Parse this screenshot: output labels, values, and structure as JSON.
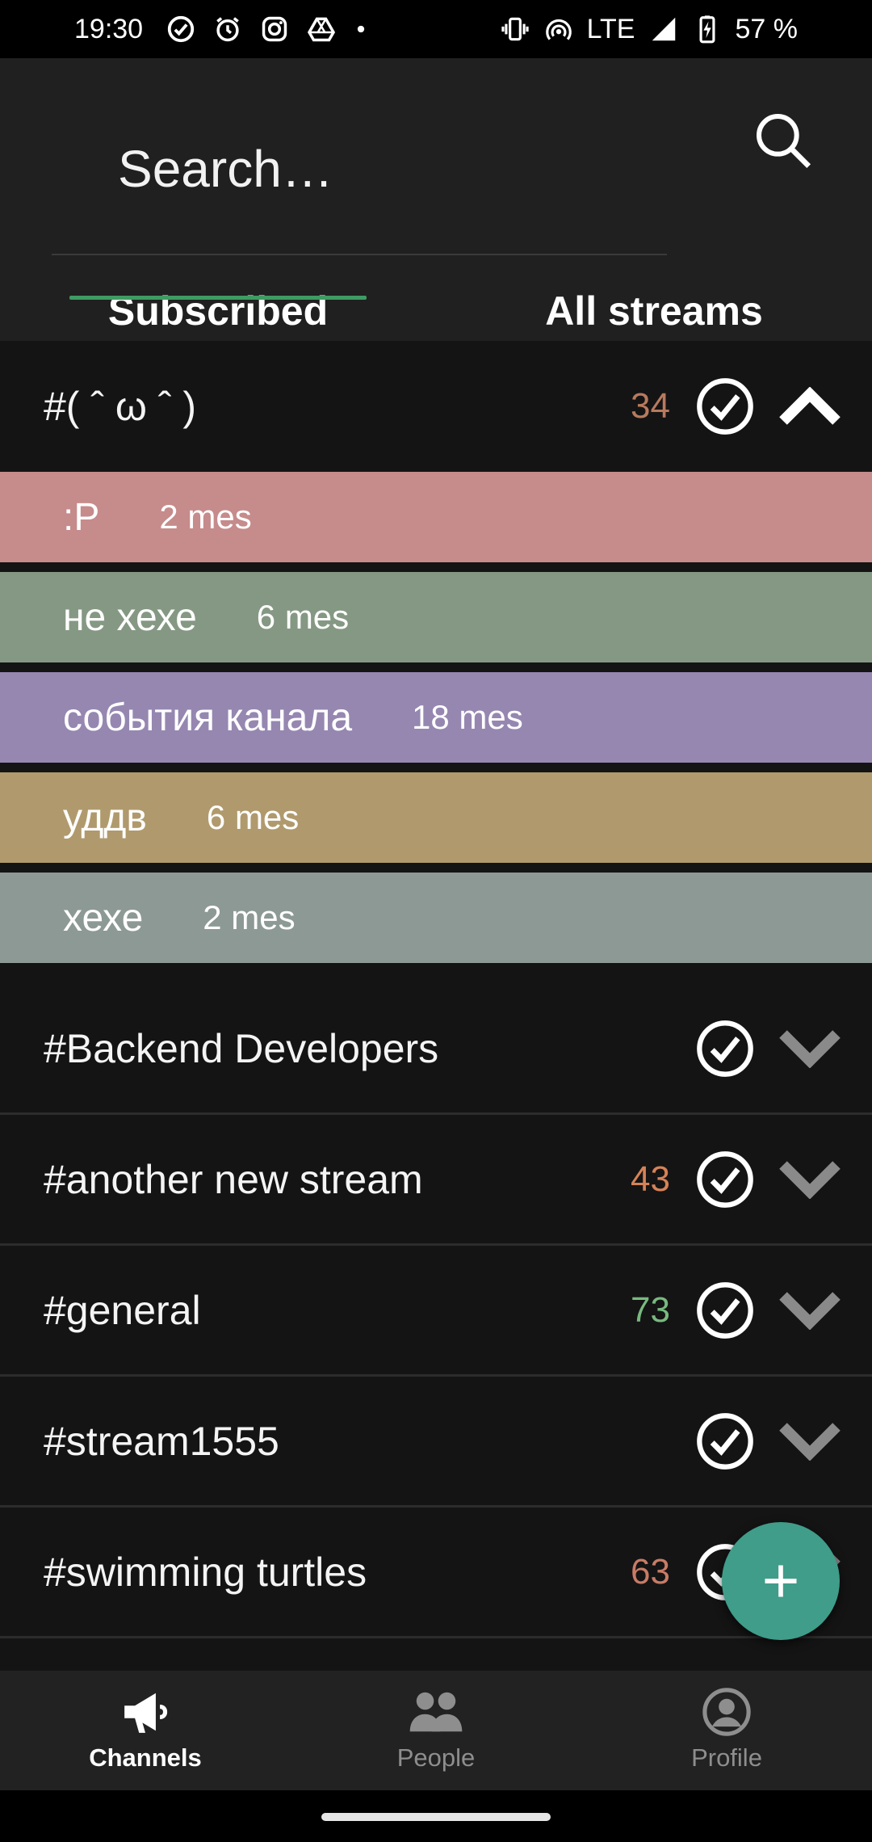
{
  "status_bar": {
    "time": "19:30",
    "network": "LTE",
    "battery": "57 %",
    "left_icons": [
      "check-circle-icon",
      "alarm-icon",
      "instagram-icon",
      "drive-icon",
      "dot-icon"
    ],
    "right_icons": [
      "vibrate-icon",
      "hotspot-icon",
      "signal-icon",
      "battery-charging-icon"
    ]
  },
  "search": {
    "placeholder": "Search…"
  },
  "tabs": [
    {
      "label": "Subscribed",
      "active": true
    },
    {
      "label": "All streams",
      "active": false
    }
  ],
  "expanded_stream": {
    "name": "#( ˆ ω ˆ )",
    "unread": "34",
    "unread_color": "#b87a5e",
    "topics": [
      {
        "name": ":P",
        "count": "2 mes",
        "color": "#c68b8b"
      },
      {
        "name": "не хехе",
        "count": "6 mes",
        "color": "#859883"
      },
      {
        "name": "события канала",
        "count": "18 mes",
        "color": "#9687b1"
      },
      {
        "name": "уддв",
        "count": "6 mes",
        "color": "#b09a6d"
      },
      {
        "name": "хехе",
        "count": "2 mes",
        "color": "#8d9994"
      }
    ]
  },
  "streams": [
    {
      "name": "#Backend Developers",
      "unread": "",
      "unread_color": "#c27a5a"
    },
    {
      "name": "#another new stream",
      "unread": "43",
      "unread_color": "#d58257"
    },
    {
      "name": "#general",
      "unread": "73",
      "unread_color": "#79b97f"
    },
    {
      "name": "#stream1555",
      "unread": "",
      "unread_color": "#c27a5a"
    },
    {
      "name": "#swimming turtles",
      "unread": "63",
      "unread_color": "#c87b66"
    }
  ],
  "fab": {
    "icon": "plus-icon"
  },
  "bottom_nav": [
    {
      "label": "Channels",
      "icon": "megaphone-icon",
      "active": true
    },
    {
      "label": "People",
      "icon": "people-icon",
      "active": false
    },
    {
      "label": "Profile",
      "icon": "profile-icon",
      "active": false
    }
  ],
  "colors": {
    "accent_green": "#3f9b63",
    "fab": "#3f9d8a",
    "background": "#141414",
    "header": "#202020"
  }
}
